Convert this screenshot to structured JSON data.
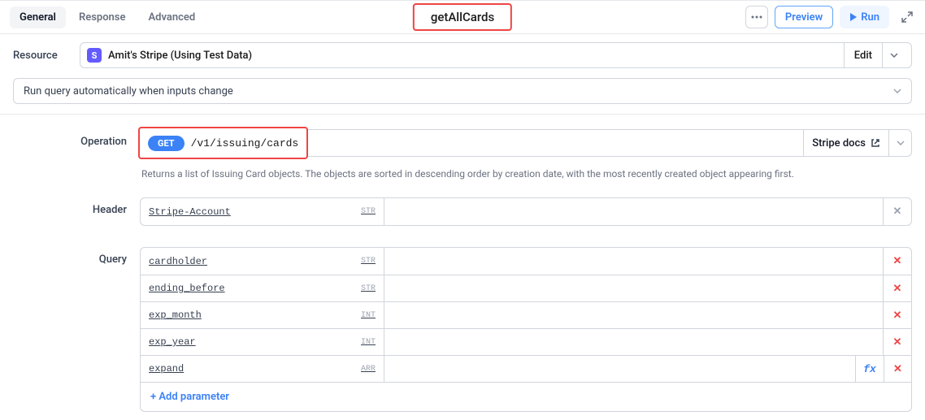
{
  "tabs": {
    "general": "General",
    "response": "Response",
    "advanced": "Advanced"
  },
  "title": "getAllCards",
  "controls": {
    "preview": "Preview",
    "run": "Run"
  },
  "resource": {
    "label": "Resource",
    "badge": "S",
    "name": "Amit's Stripe (Using Test Data)",
    "edit": "Edit"
  },
  "run_mode": "Run query automatically when inputs change",
  "operation": {
    "label": "Operation",
    "method": "GET",
    "path": "/v1/issuing/cards",
    "docs": "Stripe docs",
    "description": "Returns a list of Issuing Card objects. The objects are sorted in descending order by creation date, with the most recently created object appearing first."
  },
  "header_section": {
    "label": "Header",
    "rows": [
      {
        "key": "Stripe-Account",
        "type": "STR",
        "muted": true
      }
    ]
  },
  "query_section": {
    "label": "Query",
    "rows": [
      {
        "key": "cardholder",
        "type": "STR"
      },
      {
        "key": "ending_before",
        "type": "STR"
      },
      {
        "key": "exp_month",
        "type": "INT"
      },
      {
        "key": "exp_year",
        "type": "INT"
      },
      {
        "key": "expand",
        "type": "ARR",
        "fx": true
      }
    ],
    "add": "+ Add parameter"
  }
}
